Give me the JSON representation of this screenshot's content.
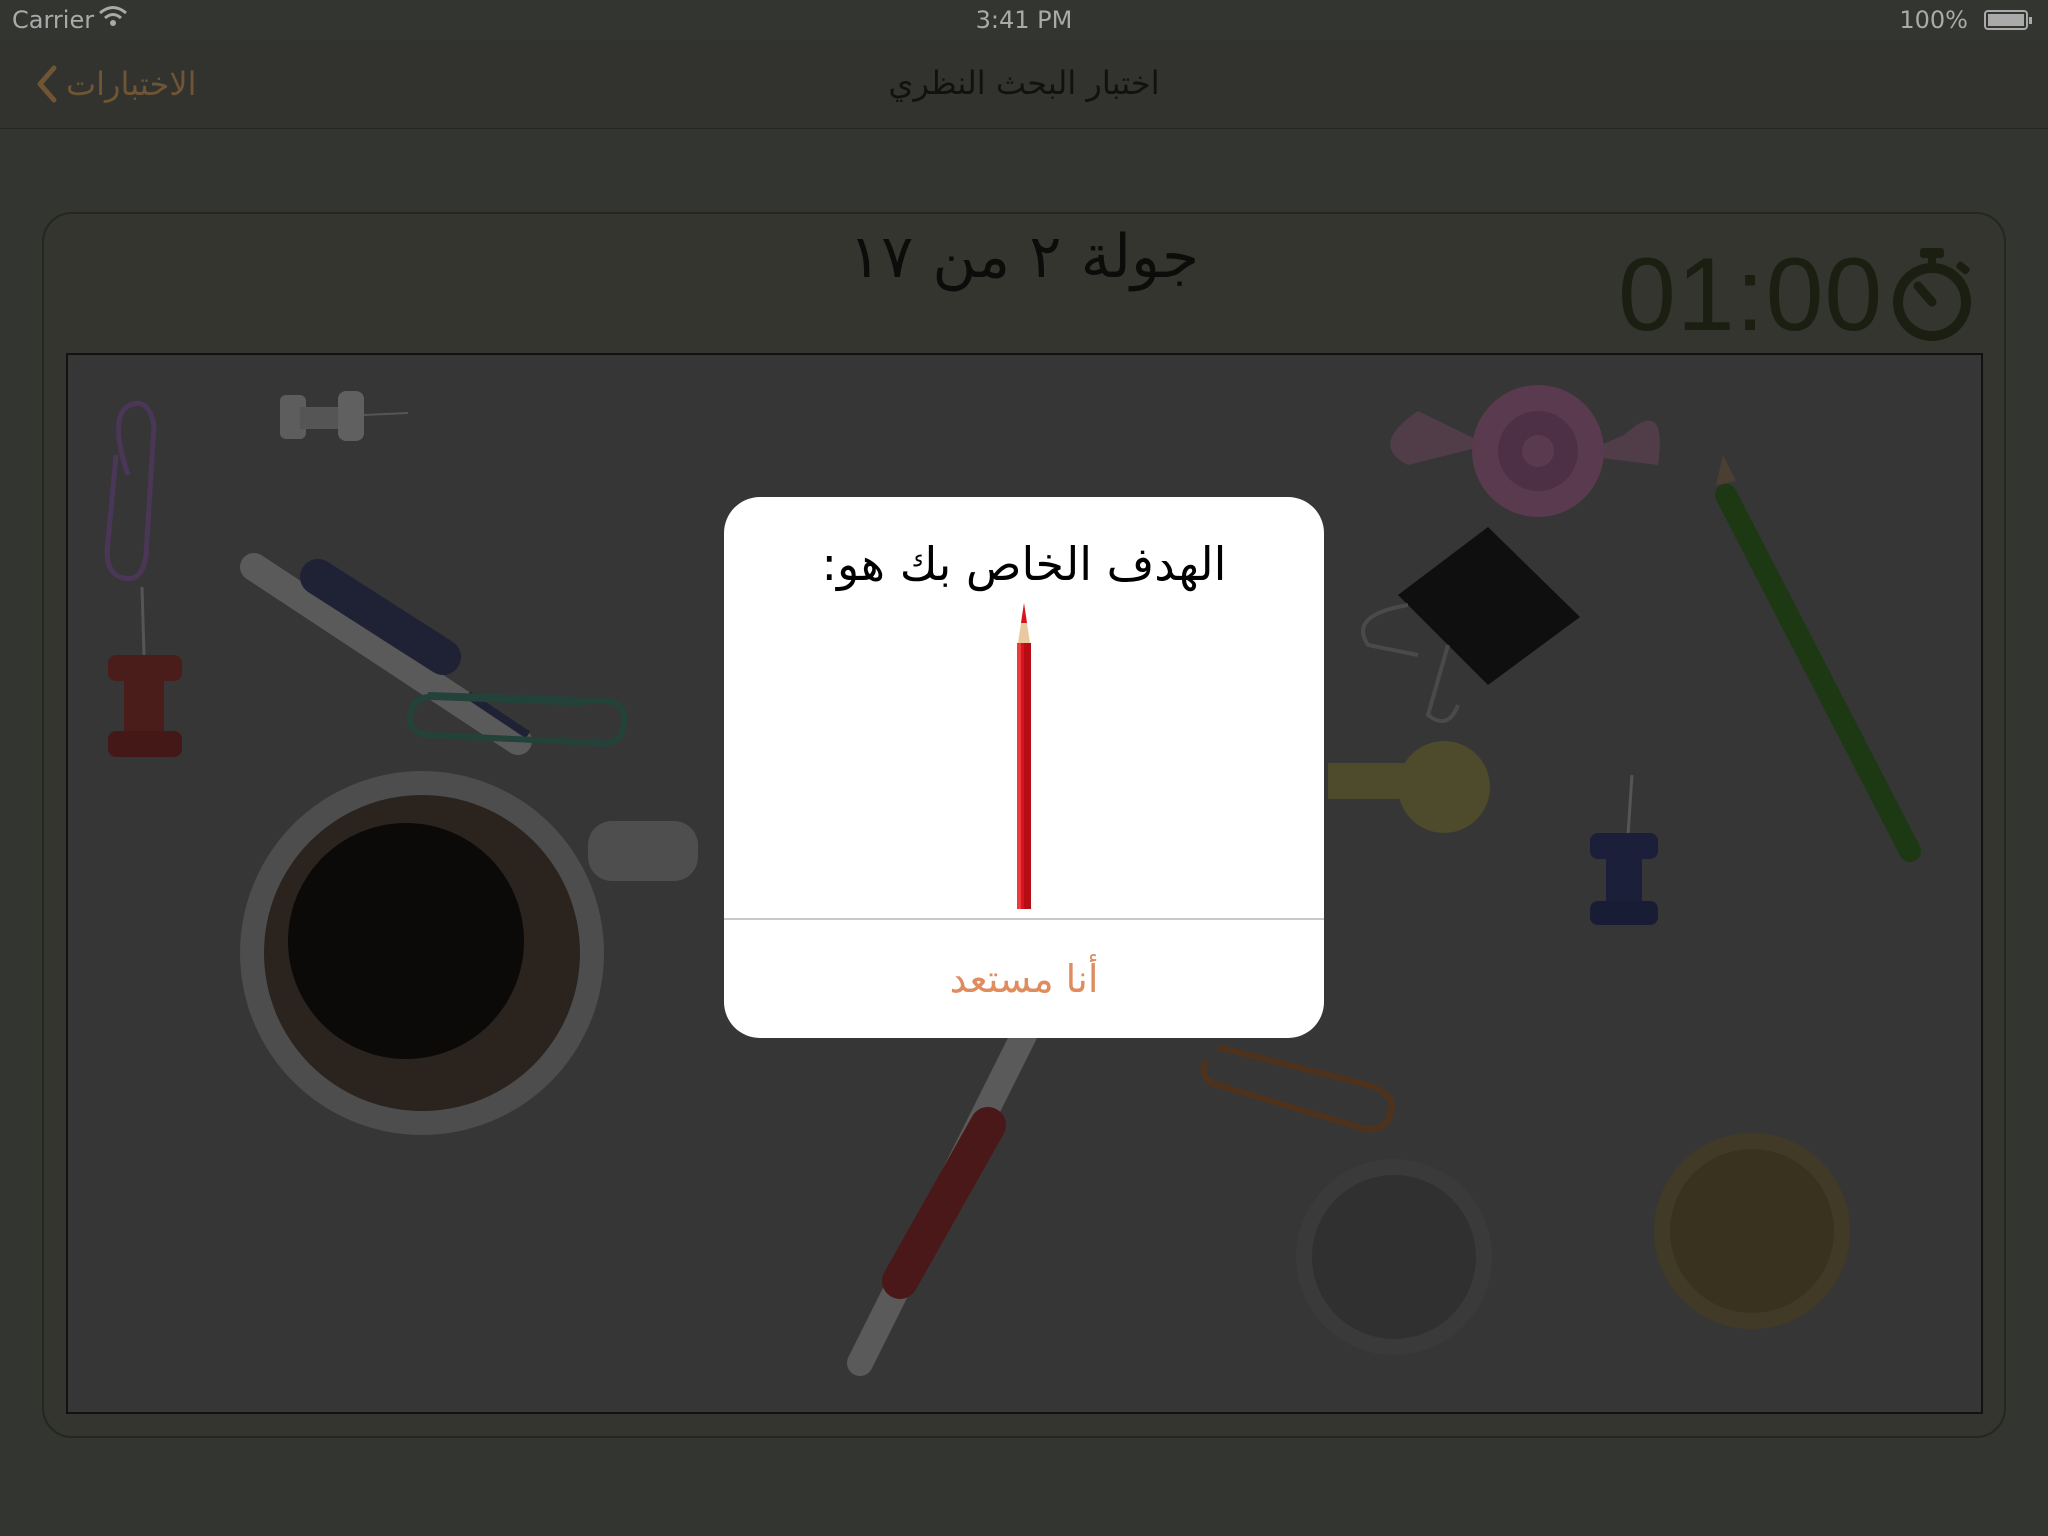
{
  "status_bar": {
    "carrier": "Carrier",
    "wifi_icon": "wifi-icon",
    "time": "3:41 PM",
    "battery": "100%",
    "battery_level": 1.0
  },
  "nav": {
    "back_label": "الاختبارات",
    "back_icon": "chevron-left-icon",
    "title": "اختبار البحث النظري",
    "accent_color": "#6f5533"
  },
  "game": {
    "round_label": "جولة ٢ من ١٧",
    "timer": "01:00",
    "timer_icon": "stopwatch-icon",
    "items": [
      "paperclip-purple",
      "pushpin-gray",
      "pen-blue",
      "pushpin-red",
      "paperclip-teal",
      "coffee-cup",
      "pen-red",
      "candy",
      "binder-clip",
      "key",
      "pencil-green",
      "pushpin-blue",
      "paperclip-orange",
      "coin-silver",
      "coin-gold"
    ]
  },
  "dialog": {
    "title": "الهدف الخاص بك هو:",
    "target_icon": "red-pencil-icon",
    "button_label": "أنا مستعد",
    "button_color": "#df8c5e"
  }
}
